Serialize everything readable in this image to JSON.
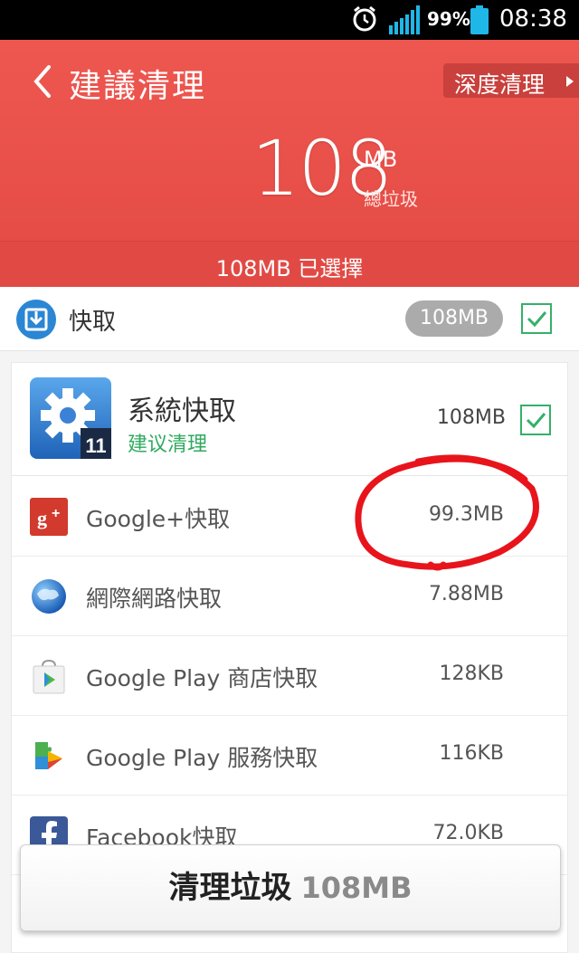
{
  "status_bar": {
    "battery_percent": "99%",
    "time": "08:38",
    "icons": [
      "alarm-clock-icon",
      "signal-icon",
      "battery-icon"
    ]
  },
  "header": {
    "title": "建議清理",
    "deep_clean_label": "深度清理",
    "total_size": "108",
    "total_unit": "MB",
    "total_label": "總垃圾",
    "selected_text": "108MB 已選擇"
  },
  "cache_section": {
    "label": "快取",
    "size": "108MB",
    "checked": true
  },
  "system_cache": {
    "title": "系統快取",
    "subtitle": "建议清理",
    "size": "108MB",
    "badge": "11",
    "checked": true
  },
  "items": [
    {
      "name": "Google+快取",
      "size": "99.3MB",
      "icon": "google-plus-icon"
    },
    {
      "name": "網際網路快取",
      "size": "7.88MB",
      "icon": "globe-icon"
    },
    {
      "name": "Google Play 商店快取",
      "size": "128KB",
      "icon": "play-store-icon"
    },
    {
      "name": "Google Play 服務快取",
      "size": "116KB",
      "icon": "play-services-icon"
    },
    {
      "name": "Facebook快取",
      "size": "72.0KB",
      "icon": "facebook-icon"
    }
  ],
  "clean_button": {
    "label": "清理垃圾",
    "amount": "108MB"
  },
  "colors": {
    "header_red": "#e34a44",
    "accent_green": "#35b06a",
    "annotation_red": "#e8141c"
  }
}
